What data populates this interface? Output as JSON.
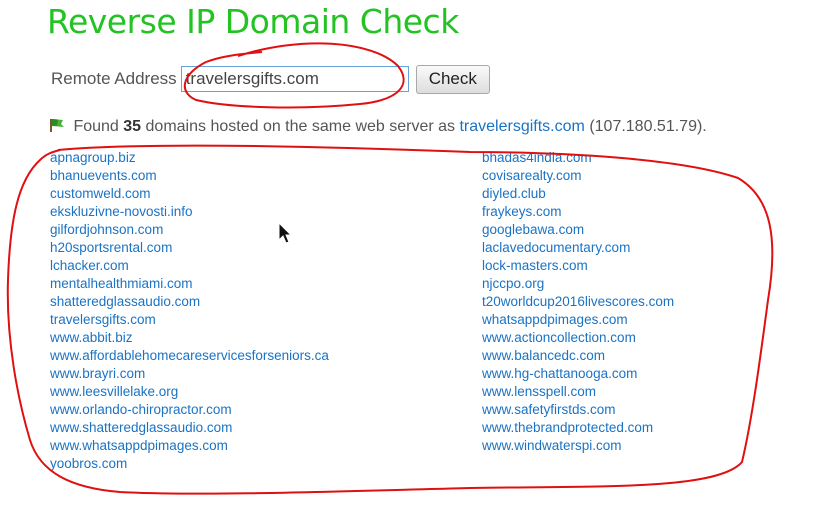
{
  "header": {
    "title": "Reverse IP Domain Check"
  },
  "form": {
    "label": "Remote Address",
    "input_value": "travelersgifts.com",
    "button_label": "Check"
  },
  "summary": {
    "icon": "flag-icon",
    "prefix": "Found",
    "count": "35",
    "middle": "domains hosted on the same web server as",
    "domain": "travelersgifts.com",
    "ip": "(107.180.51.79)."
  },
  "results": {
    "left": [
      "apnagroup.biz",
      "bhanuevents.com",
      "customweld.com",
      "ekskluzivne-novosti.info",
      "gilfordjohnson.com",
      "h20sportsrental.com",
      "lchacker.com",
      "mentalhealthmiami.com",
      "shatteredglassaudio.com",
      "travelersgifts.com",
      "www.abbit.biz",
      "www.affordablehomecareservicesforseniors.ca",
      "www.brayri.com",
      "www.leesvillelake.org",
      "www.orlando-chiropractor.com",
      "www.shatteredglassaudio.com",
      "www.whatsappdpimages.com",
      "yoobros.com"
    ],
    "right": [
      "bhadas4india.com",
      "covisarealty.com",
      "diyled.club",
      "fraykeys.com",
      "googlebawa.com",
      "laclavedocumentary.com",
      "lock-masters.com",
      "njccpo.org",
      "t20worldcup2016livescores.com",
      "whatsappdpimages.com",
      "www.actioncollection.com",
      "www.balancedc.com",
      "www.hg-chattanooga.com",
      "www.lensspell.com",
      "www.safetyfirstds.com",
      "www.thebrandprotected.com",
      "www.windwaterspi.com"
    ]
  },
  "colors": {
    "title": "#22c322",
    "link": "#1a73c4",
    "annotation": "#e01010"
  }
}
